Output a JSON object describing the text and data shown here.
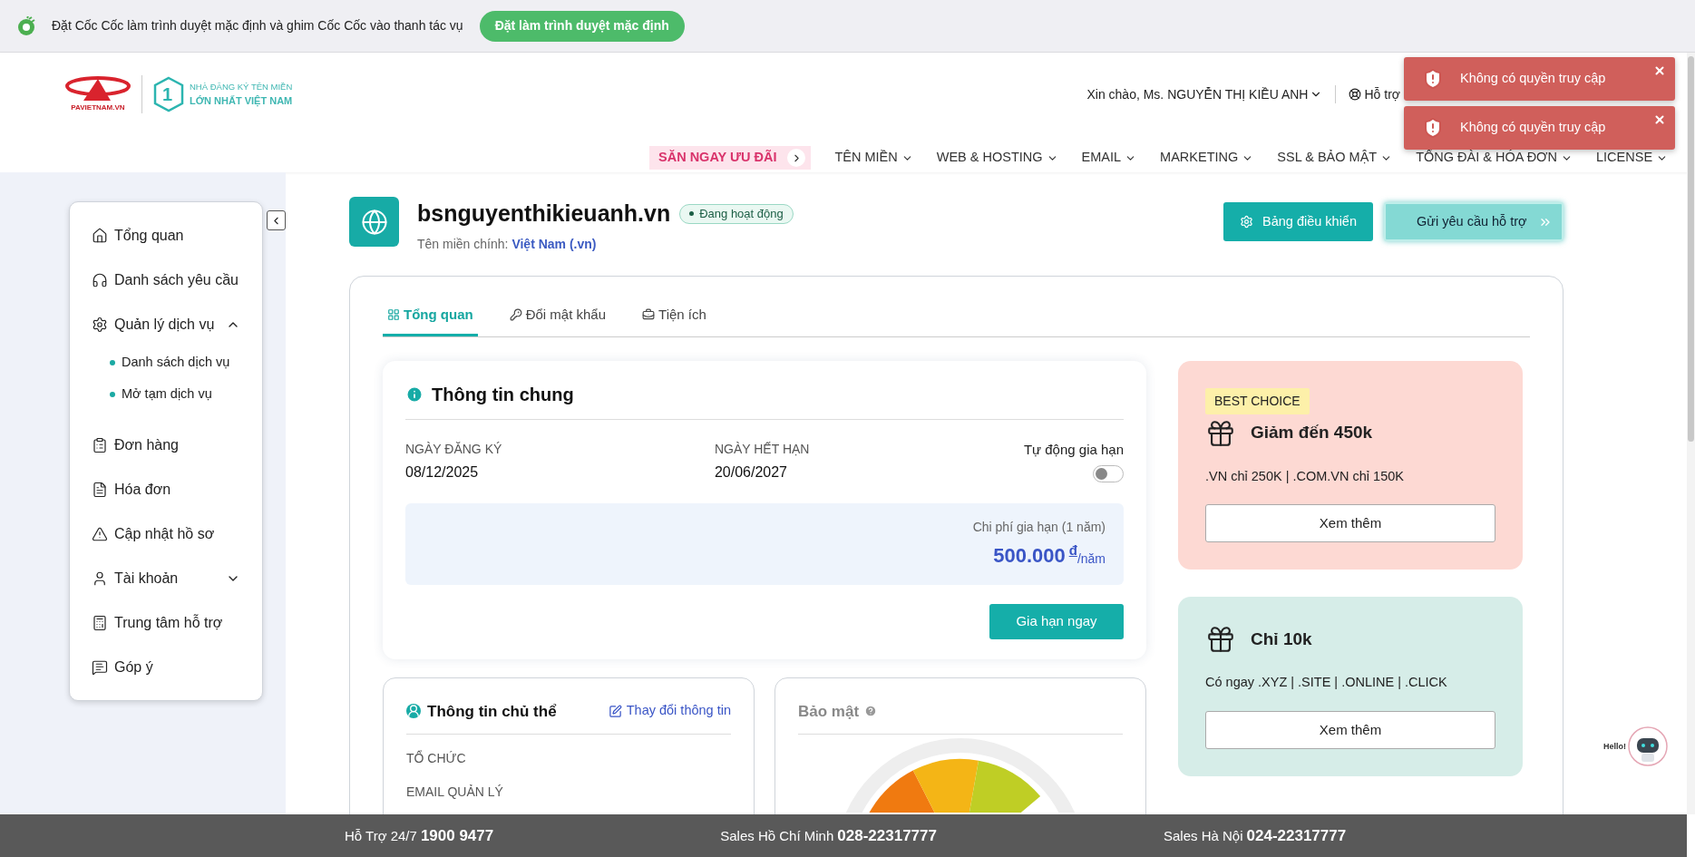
{
  "browser_banner": {
    "message": "Đặt Cốc Cốc làm trình duyệt mặc định và ghim Cốc Cốc vào thanh tác vụ",
    "button": "Đặt làm trình duyệt mặc định"
  },
  "header": {
    "logo_text": "PAVIETNAM.VN",
    "tagline_top": "NHÀ ĐĂNG KÝ TÊN MIỀN",
    "tagline_bottom": "LỚN NHẤT VIỆT NAM",
    "badge_number": "1",
    "greeting": "Xin chào, Ms. NGUYỄN THỊ KIỀU ANH",
    "support": "Hỗ trợ",
    "nav": [
      {
        "label": "SĂN NGAY ƯU ĐÃI",
        "kind": "promo"
      },
      {
        "label": "TÊN MIỀN",
        "kind": "menu"
      },
      {
        "label": "WEB & HOSTING",
        "kind": "menu"
      },
      {
        "label": "EMAIL",
        "kind": "menu"
      },
      {
        "label": "MARKETING",
        "kind": "menu"
      },
      {
        "label": "SSL & BẢO MẬT",
        "kind": "menu"
      },
      {
        "label": "TỔNG ĐÀI & HÓA ĐƠN",
        "kind": "menu"
      },
      {
        "label": "LICENSE",
        "kind": "menu"
      }
    ]
  },
  "toasts": [
    {
      "message": "Không có quyền truy cập"
    },
    {
      "message": "Không có quyền truy cập"
    }
  ],
  "sidebar": {
    "items": [
      {
        "label": "Tổng quan",
        "kind": "link"
      },
      {
        "label": "Danh sách yêu cầu",
        "kind": "link"
      },
      {
        "label": "Quản lý dịch vụ",
        "kind": "group",
        "expanded": true,
        "children": [
          {
            "label": "Danh sách dịch vụ"
          },
          {
            "label": "Mở tạm dịch vụ"
          }
        ]
      },
      {
        "label": "Đơn hàng",
        "kind": "link"
      },
      {
        "label": "Hóa đơn",
        "kind": "link"
      },
      {
        "label": "Cập nhật hồ sơ",
        "kind": "link"
      },
      {
        "label": "Tài khoản",
        "kind": "group",
        "expanded": false
      },
      {
        "label": "Trung tâm hỗ trợ",
        "kind": "link"
      },
      {
        "label": "Góp ý",
        "kind": "link"
      }
    ]
  },
  "domain": {
    "name": "bsnguyenthikieuanh.vn",
    "status": "Đang hoạt động",
    "subtitle_label": "Tên miền chính:",
    "subtitle_value": "Việt Nam (.vn)",
    "buttons": [
      {
        "label": "Bảng điều khiển",
        "kind": "primary"
      },
      {
        "label": "Gửi yêu cầu hỗ trợ",
        "kind": "secondary"
      }
    ]
  },
  "tabs": [
    {
      "label": "Tổng quan",
      "selected": true
    },
    {
      "label": "Đổi mật khẩu",
      "selected": false
    },
    {
      "label": "Tiện ích",
      "selected": false
    }
  ],
  "general_info": {
    "title": "Thông tin chung",
    "fields": [
      {
        "label": "NGÀY ĐĂNG KÝ",
        "value": "08/12/2025"
      },
      {
        "label": "NGÀY HẾT HẠN",
        "value": "20/06/2027"
      }
    ],
    "auto_renew": {
      "label": "Tự động gia hạn",
      "on": false
    },
    "cost": {
      "label": "Chi phí gia hạn (1 năm)",
      "amount": "500.000",
      "currency": "đ",
      "unit": "/năm"
    },
    "button": "Gia hạn ngay"
  },
  "owner": {
    "title": "Thông tin chủ thể",
    "edit_link": "Thay đổi thông tin",
    "fields": [
      "TỔ CHỨC",
      "EMAIL QUẢN LÝ"
    ]
  },
  "security": {
    "title": "Bảo mật"
  },
  "promos": [
    {
      "badge": "BEST CHOICE",
      "title": "Giảm đến 450k",
      "description": ".VN chỉ 250K | .COM.VN chỉ 150K",
      "button": "Xem thêm",
      "color": "#fdd9d3"
    },
    {
      "title": "Chỉ 10k",
      "description": "Có ngay .XYZ | .SITE | .ONLINE | .CLICK",
      "button": "Xem thêm",
      "color": "#d6ede8"
    }
  ],
  "chatbot": {
    "label": "Hello!"
  },
  "footer": [
    {
      "label": "Hỗ Trợ 24/7",
      "value": "1900 9477"
    },
    {
      "label": "Sales Hồ Chí Minh",
      "value": "028-22317777"
    },
    {
      "label": "Sales Hà Nội",
      "value": "024-22317777"
    }
  ]
}
